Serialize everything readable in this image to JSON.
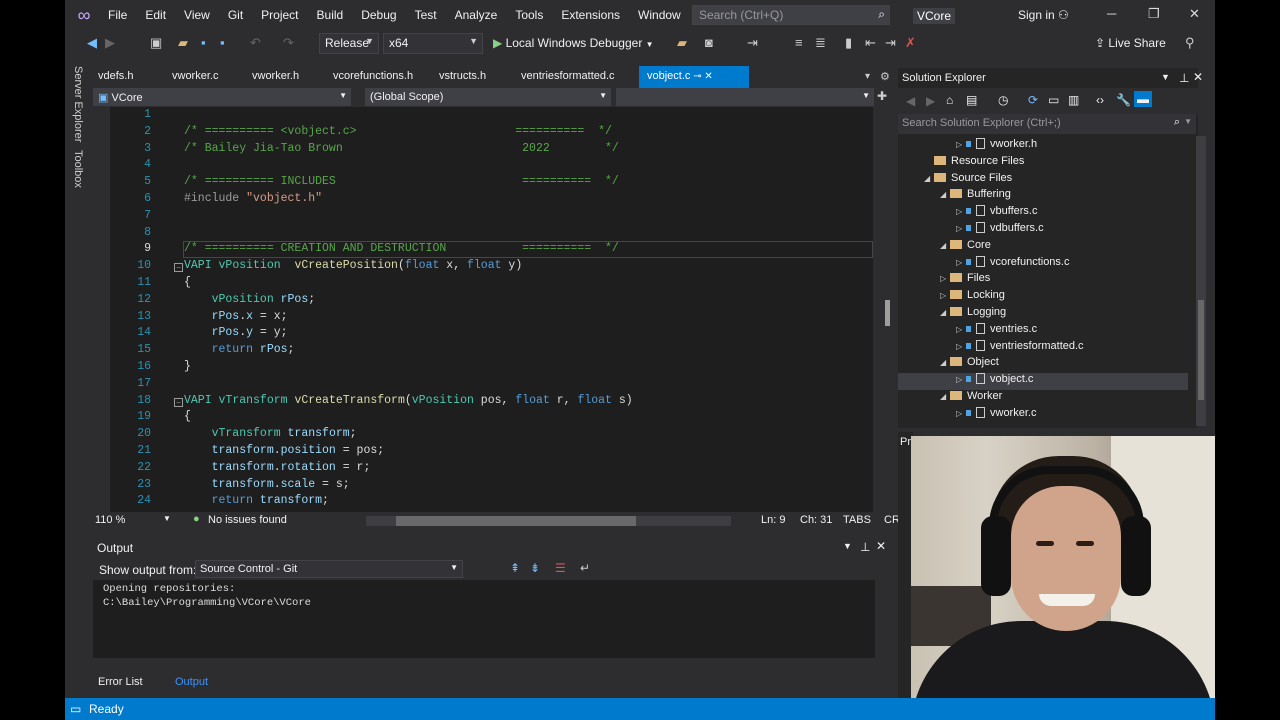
{
  "titlebar": {
    "menu": [
      "File",
      "Edit",
      "View",
      "Git",
      "Project",
      "Build",
      "Debug",
      "Test",
      "Analyze",
      "Tools",
      "Extensions",
      "Window",
      "Help"
    ],
    "search_placeholder": "Search (Ctrl+Q)",
    "solution": "VCore",
    "signin": "Sign in"
  },
  "toolbar": {
    "config": "Release",
    "platform": "x64",
    "debugger": "Local Windows Debugger",
    "live_share": "Live Share"
  },
  "rail": {
    "server_explorer": "Server Explorer",
    "toolbox": "Toolbox"
  },
  "tabs": [
    "vdefs.h",
    "vworker.c",
    "vworker.h",
    "vcorefunctions.h",
    "vstructs.h",
    "ventriesformatted.c",
    "vobject.c"
  ],
  "navbar": {
    "project": "VCore",
    "scope": "(Global Scope)"
  },
  "code_lines": [
    {
      "n": "1",
      "segs": []
    },
    {
      "n": "2",
      "segs": [
        {
          "c": "cm",
          "t": "/* ========== <vobject.c>                       ==========  */"
        }
      ]
    },
    {
      "n": "3",
      "segs": [
        {
          "c": "cm",
          "t": "/* Bailey Jia-Tao Brown                          2022        */"
        }
      ]
    },
    {
      "n": "4",
      "segs": []
    },
    {
      "n": "5",
      "segs": [
        {
          "c": "cm",
          "t": "/* ========== INCLUDES                           ==========  */"
        }
      ]
    },
    {
      "n": "6",
      "segs": [
        {
          "c": "pp",
          "t": "#include "
        },
        {
          "c": "str",
          "t": "\"vobject.h\""
        }
      ]
    },
    {
      "n": "7",
      "segs": []
    },
    {
      "n": "8",
      "segs": []
    },
    {
      "n": "9",
      "segs": [
        {
          "c": "cm",
          "t": "/* ========== CREATION AND DESTRUCTION           ==========  */"
        }
      ]
    },
    {
      "n": "10",
      "segs": [
        {
          "c": "ty",
          "t": "VAPI "
        },
        {
          "c": "ty",
          "t": "vPosition  "
        },
        {
          "c": "fn",
          "t": "vCreatePosition"
        },
        {
          "c": "",
          "t": "("
        },
        {
          "c": "kw",
          "t": "float"
        },
        {
          "c": "",
          "t": " x, "
        },
        {
          "c": "kw",
          "t": "float"
        },
        {
          "c": "",
          "t": " y)"
        }
      ]
    },
    {
      "n": "11",
      "segs": [
        {
          "c": "",
          "t": "{"
        }
      ]
    },
    {
      "n": "12",
      "segs": [
        {
          "c": "ty",
          "t": "    vPosition "
        },
        {
          "c": "var",
          "t": "rPos"
        },
        {
          "c": "",
          "t": ";"
        }
      ]
    },
    {
      "n": "13",
      "segs": [
        {
          "c": "var",
          "t": "    rPos"
        },
        {
          "c": "",
          "t": "."
        },
        {
          "c": "var",
          "t": "x"
        },
        {
          "c": "",
          "t": " = x;"
        }
      ]
    },
    {
      "n": "14",
      "segs": [
        {
          "c": "var",
          "t": "    rPos"
        },
        {
          "c": "",
          "t": "."
        },
        {
          "c": "var",
          "t": "y"
        },
        {
          "c": "",
          "t": " = y;"
        }
      ]
    },
    {
      "n": "15",
      "segs": [
        {
          "c": "kw",
          "t": "    return "
        },
        {
          "c": "var",
          "t": "rPos"
        },
        {
          "c": "",
          "t": ";"
        }
      ]
    },
    {
      "n": "16",
      "segs": [
        {
          "c": "",
          "t": "}"
        }
      ]
    },
    {
      "n": "17",
      "segs": []
    },
    {
      "n": "18",
      "segs": [
        {
          "c": "ty",
          "t": "VAPI "
        },
        {
          "c": "ty",
          "t": "vTransform "
        },
        {
          "c": "fn",
          "t": "vCreateTransform"
        },
        {
          "c": "",
          "t": "("
        },
        {
          "c": "ty",
          "t": "vPosition"
        },
        {
          "c": "",
          "t": " pos, "
        },
        {
          "c": "kw",
          "t": "float"
        },
        {
          "c": "",
          "t": " r, "
        },
        {
          "c": "kw",
          "t": "float"
        },
        {
          "c": "",
          "t": " s)"
        }
      ]
    },
    {
      "n": "19",
      "segs": [
        {
          "c": "",
          "t": "{"
        }
      ]
    },
    {
      "n": "20",
      "segs": [
        {
          "c": "ty",
          "t": "    vTransform "
        },
        {
          "c": "var",
          "t": "transform"
        },
        {
          "c": "",
          "t": ";"
        }
      ]
    },
    {
      "n": "21",
      "segs": [
        {
          "c": "var",
          "t": "    transform"
        },
        {
          "c": "",
          "t": "."
        },
        {
          "c": "var",
          "t": "position"
        },
        {
          "c": "",
          "t": " = pos;"
        }
      ]
    },
    {
      "n": "22",
      "segs": [
        {
          "c": "var",
          "t": "    transform"
        },
        {
          "c": "",
          "t": "."
        },
        {
          "c": "var",
          "t": "rotation"
        },
        {
          "c": "",
          "t": " = r;"
        }
      ]
    },
    {
      "n": "23",
      "segs": [
        {
          "c": "var",
          "t": "    transform"
        },
        {
          "c": "",
          "t": "."
        },
        {
          "c": "var",
          "t": "scale"
        },
        {
          "c": "",
          "t": " = s;"
        }
      ]
    },
    {
      "n": "24",
      "segs": [
        {
          "c": "kw",
          "t": "    return "
        },
        {
          "c": "var",
          "t": "transform"
        },
        {
          "c": "",
          "t": ";"
        }
      ]
    }
  ],
  "editor_status": {
    "zoom": "110 %",
    "issues": "No issues found",
    "ln": "Ln: 9",
    "ch": "Ch: 31",
    "tabs": "TABS",
    "eol": "CRLF"
  },
  "output": {
    "title": "Output",
    "show_from_label": "Show output from:",
    "source": "Source Control - Git",
    "lines": [
      "Opening repositories:",
      "C:\\Bailey\\Programming\\VCore\\VCore"
    ]
  },
  "bottom_tabs": [
    "Error List",
    "Output"
  ],
  "status": {
    "text": "Ready"
  },
  "solution_explorer": {
    "title": "Solution Explorer",
    "search": "Search Solution Explorer (Ctrl+;)",
    "items": [
      {
        "label": "vworker.h",
        "kind": "file",
        "depth": 3,
        "expander": "collapsed"
      },
      {
        "label": "Resource Files",
        "kind": "folder",
        "depth": 1,
        "expander": "none"
      },
      {
        "label": "Source Files",
        "kind": "folder",
        "depth": 1,
        "expander": "expanded"
      },
      {
        "label": "Buffering",
        "kind": "folder",
        "depth": 2,
        "expander": "expanded"
      },
      {
        "label": "vbuffers.c",
        "kind": "file",
        "depth": 3,
        "expander": "collapsed"
      },
      {
        "label": "vdbuffers.c",
        "kind": "file",
        "depth": 3,
        "expander": "collapsed"
      },
      {
        "label": "Core",
        "kind": "folder",
        "depth": 2,
        "expander": "expanded"
      },
      {
        "label": "vcorefunctions.c",
        "kind": "file",
        "depth": 3,
        "expander": "collapsed"
      },
      {
        "label": "Files",
        "kind": "folder",
        "depth": 2,
        "expander": "collapsed"
      },
      {
        "label": "Locking",
        "kind": "folder",
        "depth": 2,
        "expander": "collapsed"
      },
      {
        "label": "Logging",
        "kind": "folder",
        "depth": 2,
        "expander": "expanded"
      },
      {
        "label": "ventries.c",
        "kind": "file",
        "depth": 3,
        "expander": "collapsed"
      },
      {
        "label": "ventriesformatted.c",
        "kind": "file",
        "depth": 3,
        "expander": "collapsed"
      },
      {
        "label": "Object",
        "kind": "folder",
        "depth": 2,
        "expander": "expanded"
      },
      {
        "label": "vobject.c",
        "kind": "file",
        "depth": 3,
        "expander": "collapsed",
        "selected": true
      },
      {
        "label": "Worker",
        "kind": "folder",
        "depth": 2,
        "expander": "expanded"
      },
      {
        "label": "vworker.c",
        "kind": "file",
        "depth": 3,
        "expander": "collapsed"
      }
    ]
  },
  "properties_stub": "Pr"
}
